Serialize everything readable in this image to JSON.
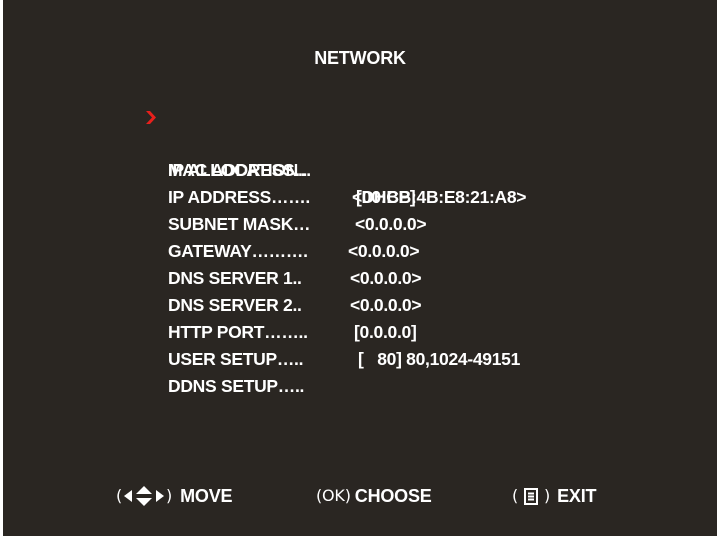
{
  "title": "NETWORK",
  "menu": [
    {
      "label": "MAC ADDRESS…",
      "value": "<00:BB:4B:E8:21:A8>"
    },
    {
      "label": "IP ALLOCATION..",
      "value": "[DHCP]"
    },
    {
      "label": "IP ADDRESS…….",
      "value": "<0.0.0.0>"
    },
    {
      "label": "SUBNET MASK…",
      "value": "<0.0.0.0>"
    },
    {
      "label": "GATEWAY……….",
      "value": "<0.0.0.0>"
    },
    {
      "label": "DNS SERVER 1..",
      "value": "<0.0.0.0>"
    },
    {
      "label": "DNS SERVER 2..",
      "value": "[0.0.0.0]"
    },
    {
      "label": "HTTP PORT……..",
      "value": "[   80] 80,1024-49151"
    },
    {
      "label": "USER SETUP…..",
      "value": ""
    },
    {
      "label": "DDNS SETUP…..",
      "value": ""
    }
  ],
  "selected_index": 0,
  "footer": {
    "move_open": "(",
    "move_close": ")",
    "move_label": "MOVE",
    "choose_key": "(OK)",
    "choose_label": "CHOOSE",
    "exit_open": "(",
    "exit_close": ")",
    "exit_label": "EXIT",
    "icons": [
      "left-arrow-icon",
      "up-down-arrow-icon",
      "right-arrow-icon",
      "menu-icon"
    ]
  },
  "colors": {
    "background": "#2a2622",
    "text": "#ffffff",
    "cursor": "#e8201c"
  }
}
